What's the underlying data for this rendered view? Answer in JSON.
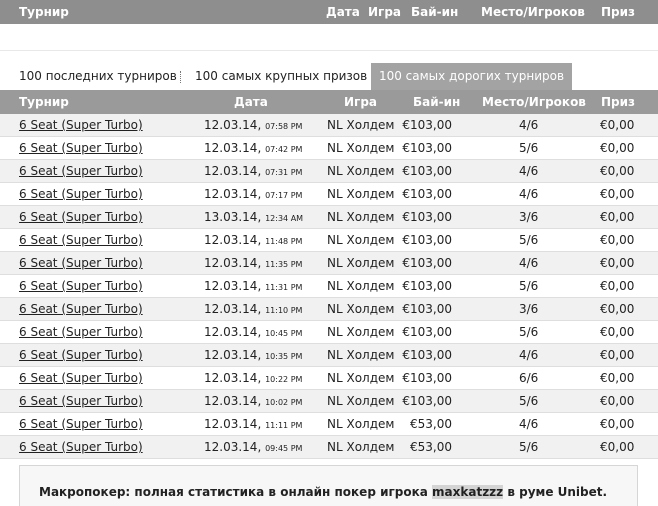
{
  "top_header": {
    "tournament": "Турнир",
    "date": "Дата",
    "game": "Игра",
    "buyin": "Бай-ин",
    "place": "Место/Игроков",
    "prize": "Приз"
  },
  "tabs": [
    {
      "label": "100 последних турниров",
      "active": false
    },
    {
      "label": "100 самых крупных призов",
      "active": false
    },
    {
      "label": "100 самых дорогих турниров",
      "active": true
    }
  ],
  "table": {
    "headers": {
      "tournament": "Турнир",
      "date": "Дата",
      "game": "Игра",
      "buyin": "Бай-ин",
      "place": "Место/Игроков",
      "prize": "Приз"
    },
    "rows": [
      {
        "name": "6 Seat (Super Turbo)",
        "date": "12.03.14,",
        "time": "07:58 PM",
        "game": "NL Холдем",
        "buyin": "€103,00",
        "place": "4/6",
        "prize": "€0,00"
      },
      {
        "name": "6 Seat (Super Turbo)",
        "date": "12.03.14,",
        "time": "07:42 PM",
        "game": "NL Холдем",
        "buyin": "€103,00",
        "place": "5/6",
        "prize": "€0,00"
      },
      {
        "name": "6 Seat (Super Turbo)",
        "date": "12.03.14,",
        "time": "07:31 PM",
        "game": "NL Холдем",
        "buyin": "€103,00",
        "place": "4/6",
        "prize": "€0,00"
      },
      {
        "name": "6 Seat (Super Turbo)",
        "date": "12.03.14,",
        "time": "07:17 PM",
        "game": "NL Холдем",
        "buyin": "€103,00",
        "place": "4/6",
        "prize": "€0,00"
      },
      {
        "name": "6 Seat (Super Turbo)",
        "date": "13.03.14,",
        "time": "12:34 AM",
        "game": "NL Холдем",
        "buyin": "€103,00",
        "place": "3/6",
        "prize": "€0,00"
      },
      {
        "name": "6 Seat (Super Turbo)",
        "date": "12.03.14,",
        "time": "11:48 PM",
        "game": "NL Холдем",
        "buyin": "€103,00",
        "place": "5/6",
        "prize": "€0,00"
      },
      {
        "name": "6 Seat (Super Turbo)",
        "date": "12.03.14,",
        "time": "11:35 PM",
        "game": "NL Холдем",
        "buyin": "€103,00",
        "place": "4/6",
        "prize": "€0,00"
      },
      {
        "name": "6 Seat (Super Turbo)",
        "date": "12.03.14,",
        "time": "11:31 PM",
        "game": "NL Холдем",
        "buyin": "€103,00",
        "place": "5/6",
        "prize": "€0,00"
      },
      {
        "name": "6 Seat (Super Turbo)",
        "date": "12.03.14,",
        "time": "11:10 PM",
        "game": "NL Холдем",
        "buyin": "€103,00",
        "place": "3/6",
        "prize": "€0,00"
      },
      {
        "name": "6 Seat (Super Turbo)",
        "date": "12.03.14,",
        "time": "10:45 PM",
        "game": "NL Холдем",
        "buyin": "€103,00",
        "place": "5/6",
        "prize": "€0,00"
      },
      {
        "name": "6 Seat (Super Turbo)",
        "date": "12.03.14,",
        "time": "10:35 PM",
        "game": "NL Холдем",
        "buyin": "€103,00",
        "place": "4/6",
        "prize": "€0,00"
      },
      {
        "name": "6 Seat (Super Turbo)",
        "date": "12.03.14,",
        "time": "10:22 PM",
        "game": "NL Холдем",
        "buyin": "€103,00",
        "place": "6/6",
        "prize": "€0,00"
      },
      {
        "name": "6 Seat (Super Turbo)",
        "date": "12.03.14,",
        "time": "10:02 PM",
        "game": "NL Холдем",
        "buyin": "€103,00",
        "place": "5/6",
        "prize": "€0,00"
      },
      {
        "name": "6 Seat (Super Turbo)",
        "date": "12.03.14,",
        "time": "11:11 PM",
        "game": "NL Холдем",
        "buyin": "€53,00",
        "place": "4/6",
        "prize": "€0,00"
      },
      {
        "name": "6 Seat (Super Turbo)",
        "date": "12.03.14,",
        "time": "09:45 PM",
        "game": "NL Холдем",
        "buyin": "€53,00",
        "place": "5/6",
        "prize": "€0,00"
      }
    ]
  },
  "footer": {
    "prefix": "Макропокер: полная статистика в онлайн покер игрока",
    "player": "maxkatzzz",
    "suffix": "в руме Unibet."
  }
}
